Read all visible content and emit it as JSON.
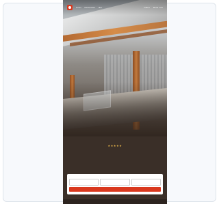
{
  "nav": {
    "links": [
      "Hotel",
      "Restaurant",
      "Bar"
    ],
    "right_links": [
      "Offers",
      "Book now"
    ]
  },
  "hero": {
    "rating": "★★★★★",
    "headline": "",
    "subline": ""
  },
  "booking": {
    "title": "",
    "fields": [
      {
        "key": "",
        "value": ""
      },
      {
        "key": "",
        "value": ""
      },
      {
        "key": "",
        "value": ""
      }
    ],
    "search_label": ""
  },
  "colors": {
    "accent": "#d9381e",
    "panel": "#3a2f28",
    "stars": "#e8b64b"
  }
}
